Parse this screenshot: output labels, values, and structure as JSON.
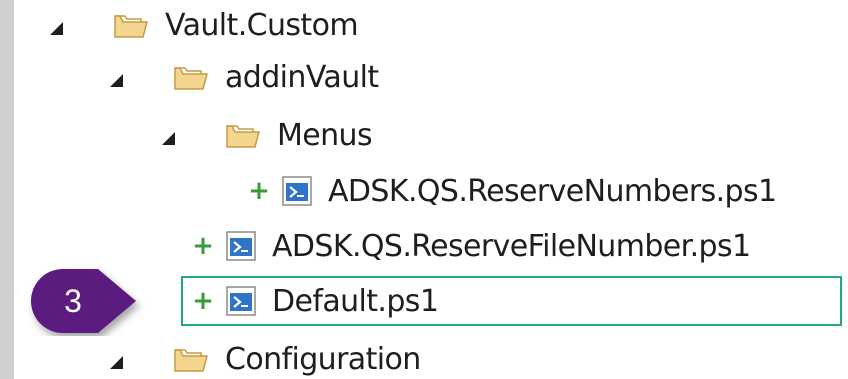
{
  "tree": {
    "items": [
      {
        "label": "Vault.Custom",
        "icon": "folder-open-icon"
      },
      {
        "label": "addinVault",
        "icon": "folder-open-icon"
      },
      {
        "label": "Menus",
        "icon": "folder-open-icon"
      },
      {
        "label": "ADSK.QS.ReserveNumbers.ps1",
        "icon": "powershell-file-icon",
        "status": "added"
      },
      {
        "label": "ADSK.QS.ReserveFileNumber.ps1",
        "icon": "powershell-file-icon",
        "status": "added"
      },
      {
        "label": "Default.ps1",
        "icon": "powershell-file-icon",
        "status": "added",
        "highlighted": true
      },
      {
        "label": "Configuration",
        "icon": "folder-open-icon"
      }
    ]
  },
  "callout": {
    "number": "3",
    "color": "#5b1f7f"
  },
  "colors": {
    "added": "#3a9a3a",
    "highlight": "#21a889",
    "folder": "#e8b96a"
  }
}
